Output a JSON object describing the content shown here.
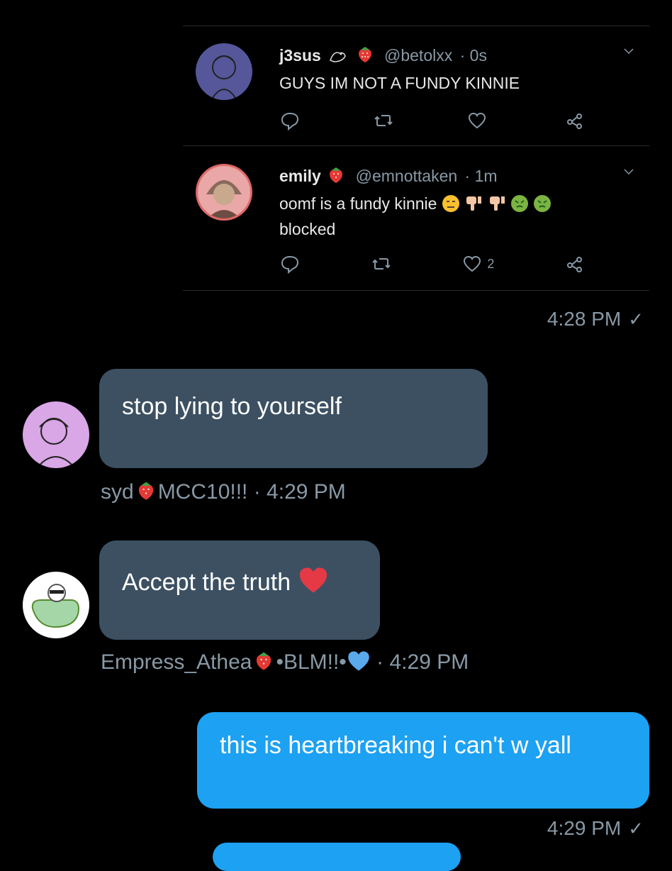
{
  "quoted_thread": {
    "tweets": [
      {
        "name": "j3sus",
        "name_emojis": [
          "frog-icon",
          "strawberry-icon"
        ],
        "handle": "@betolxx",
        "time": "· 0s",
        "text": "GUYS IM NOT A FUNDY KINNIE",
        "likes": ""
      },
      {
        "name": "emily",
        "name_emojis": [
          "strawberry-icon"
        ],
        "handle": "@emnottaken",
        "time": "· 1m",
        "text": "oomf is a fundy kinnie",
        "text_emojis": [
          "unamused-face-icon",
          "thumbs-down-icon",
          "thumbs-down-icon",
          "nauseated-face-icon",
          "nauseated-face-icon"
        ],
        "text_line2": "blocked",
        "likes": "2"
      }
    ]
  },
  "messages": [
    {
      "type": "timestamp",
      "text": "4:28 PM",
      "status": "✓"
    },
    {
      "type": "incoming",
      "text": "stop lying to yourself",
      "sender": "syd",
      "sender_suffix": "MCC10!!!",
      "time": "· 4:29 PM"
    },
    {
      "type": "incoming",
      "text": "Accept the truth",
      "sender": "Empress_Athea",
      "sender_suffix": "•BLM!!•",
      "time": "· 4:29 PM"
    },
    {
      "type": "outgoing",
      "text": "this is heartbreaking i can't w yall"
    },
    {
      "type": "timestamp",
      "text": "4:29 PM",
      "status": "✓"
    }
  ],
  "colors": {
    "background": "#000000",
    "incoming_bubble": "#3c5062",
    "outgoing_bubble": "#1da1f2",
    "muted_text": "#8899a6"
  }
}
